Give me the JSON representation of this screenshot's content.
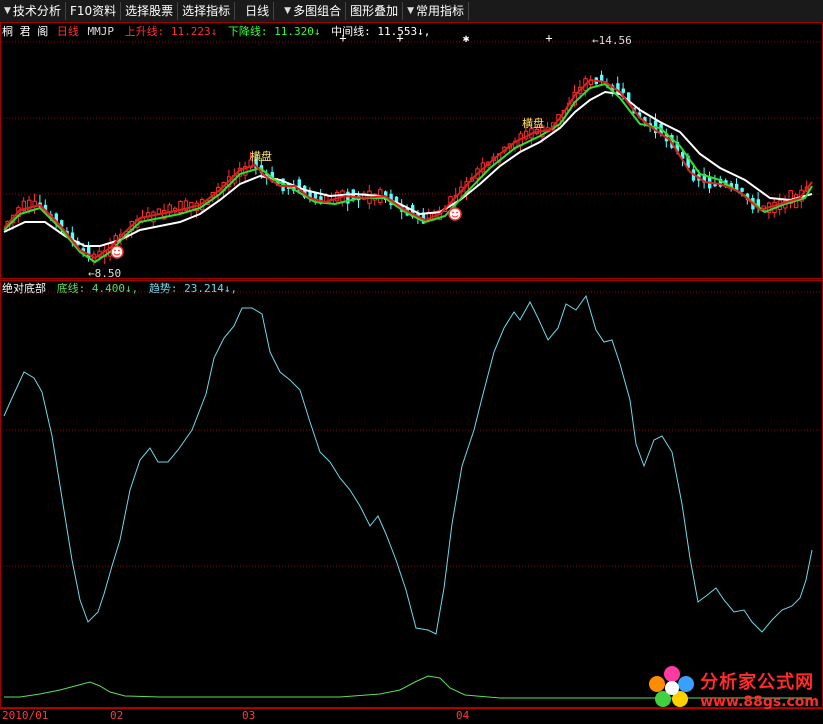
{
  "toolbar": {
    "items": [
      {
        "label": "技术分析",
        "dropdown": true
      },
      {
        "label": "F10资料",
        "dropdown": false
      },
      {
        "label": "选择股票",
        "dropdown": false
      },
      {
        "label": "选择指标",
        "dropdown": false
      },
      {
        "label": "日线",
        "dropdown": false
      },
      {
        "label": "多图组合",
        "dropdown": true
      },
      {
        "label": "图形叠加",
        "dropdown": false
      },
      {
        "label": "常用指标",
        "dropdown": true
      }
    ]
  },
  "main_panel": {
    "stock_name": "桐 君 阁",
    "period": "日线",
    "indicator": "MMJP",
    "up_label": "上升线:",
    "up_value": "11.223",
    "down_label": "下降线:",
    "down_value": "11.320",
    "mid_label": "中间线:",
    "mid_value": "11.553",
    "arrow": "↓",
    "high_label": "14.56",
    "low_label": "8.50",
    "signal_text": "横盘",
    "colors": {
      "up": "#ff3030",
      "down": "#30ff30",
      "mid": "#ffffff",
      "bull": "#ff3030",
      "bear": "#54ffff"
    }
  },
  "sub_panel": {
    "name": "绝对底部",
    "bottom_label": "底线:",
    "bottom_value": "4.400",
    "trend_label": "趋势:",
    "trend_value": "23.214",
    "arrow": "↓",
    "colors": {
      "trend": "#6fd8e8",
      "bottom": "#5fdc5f"
    }
  },
  "time_axis": {
    "labels": [
      "2010/01",
      "02",
      "03",
      "04"
    ]
  },
  "watermark": {
    "name": "分析家公式网",
    "url": "www.88gs.com"
  }
}
